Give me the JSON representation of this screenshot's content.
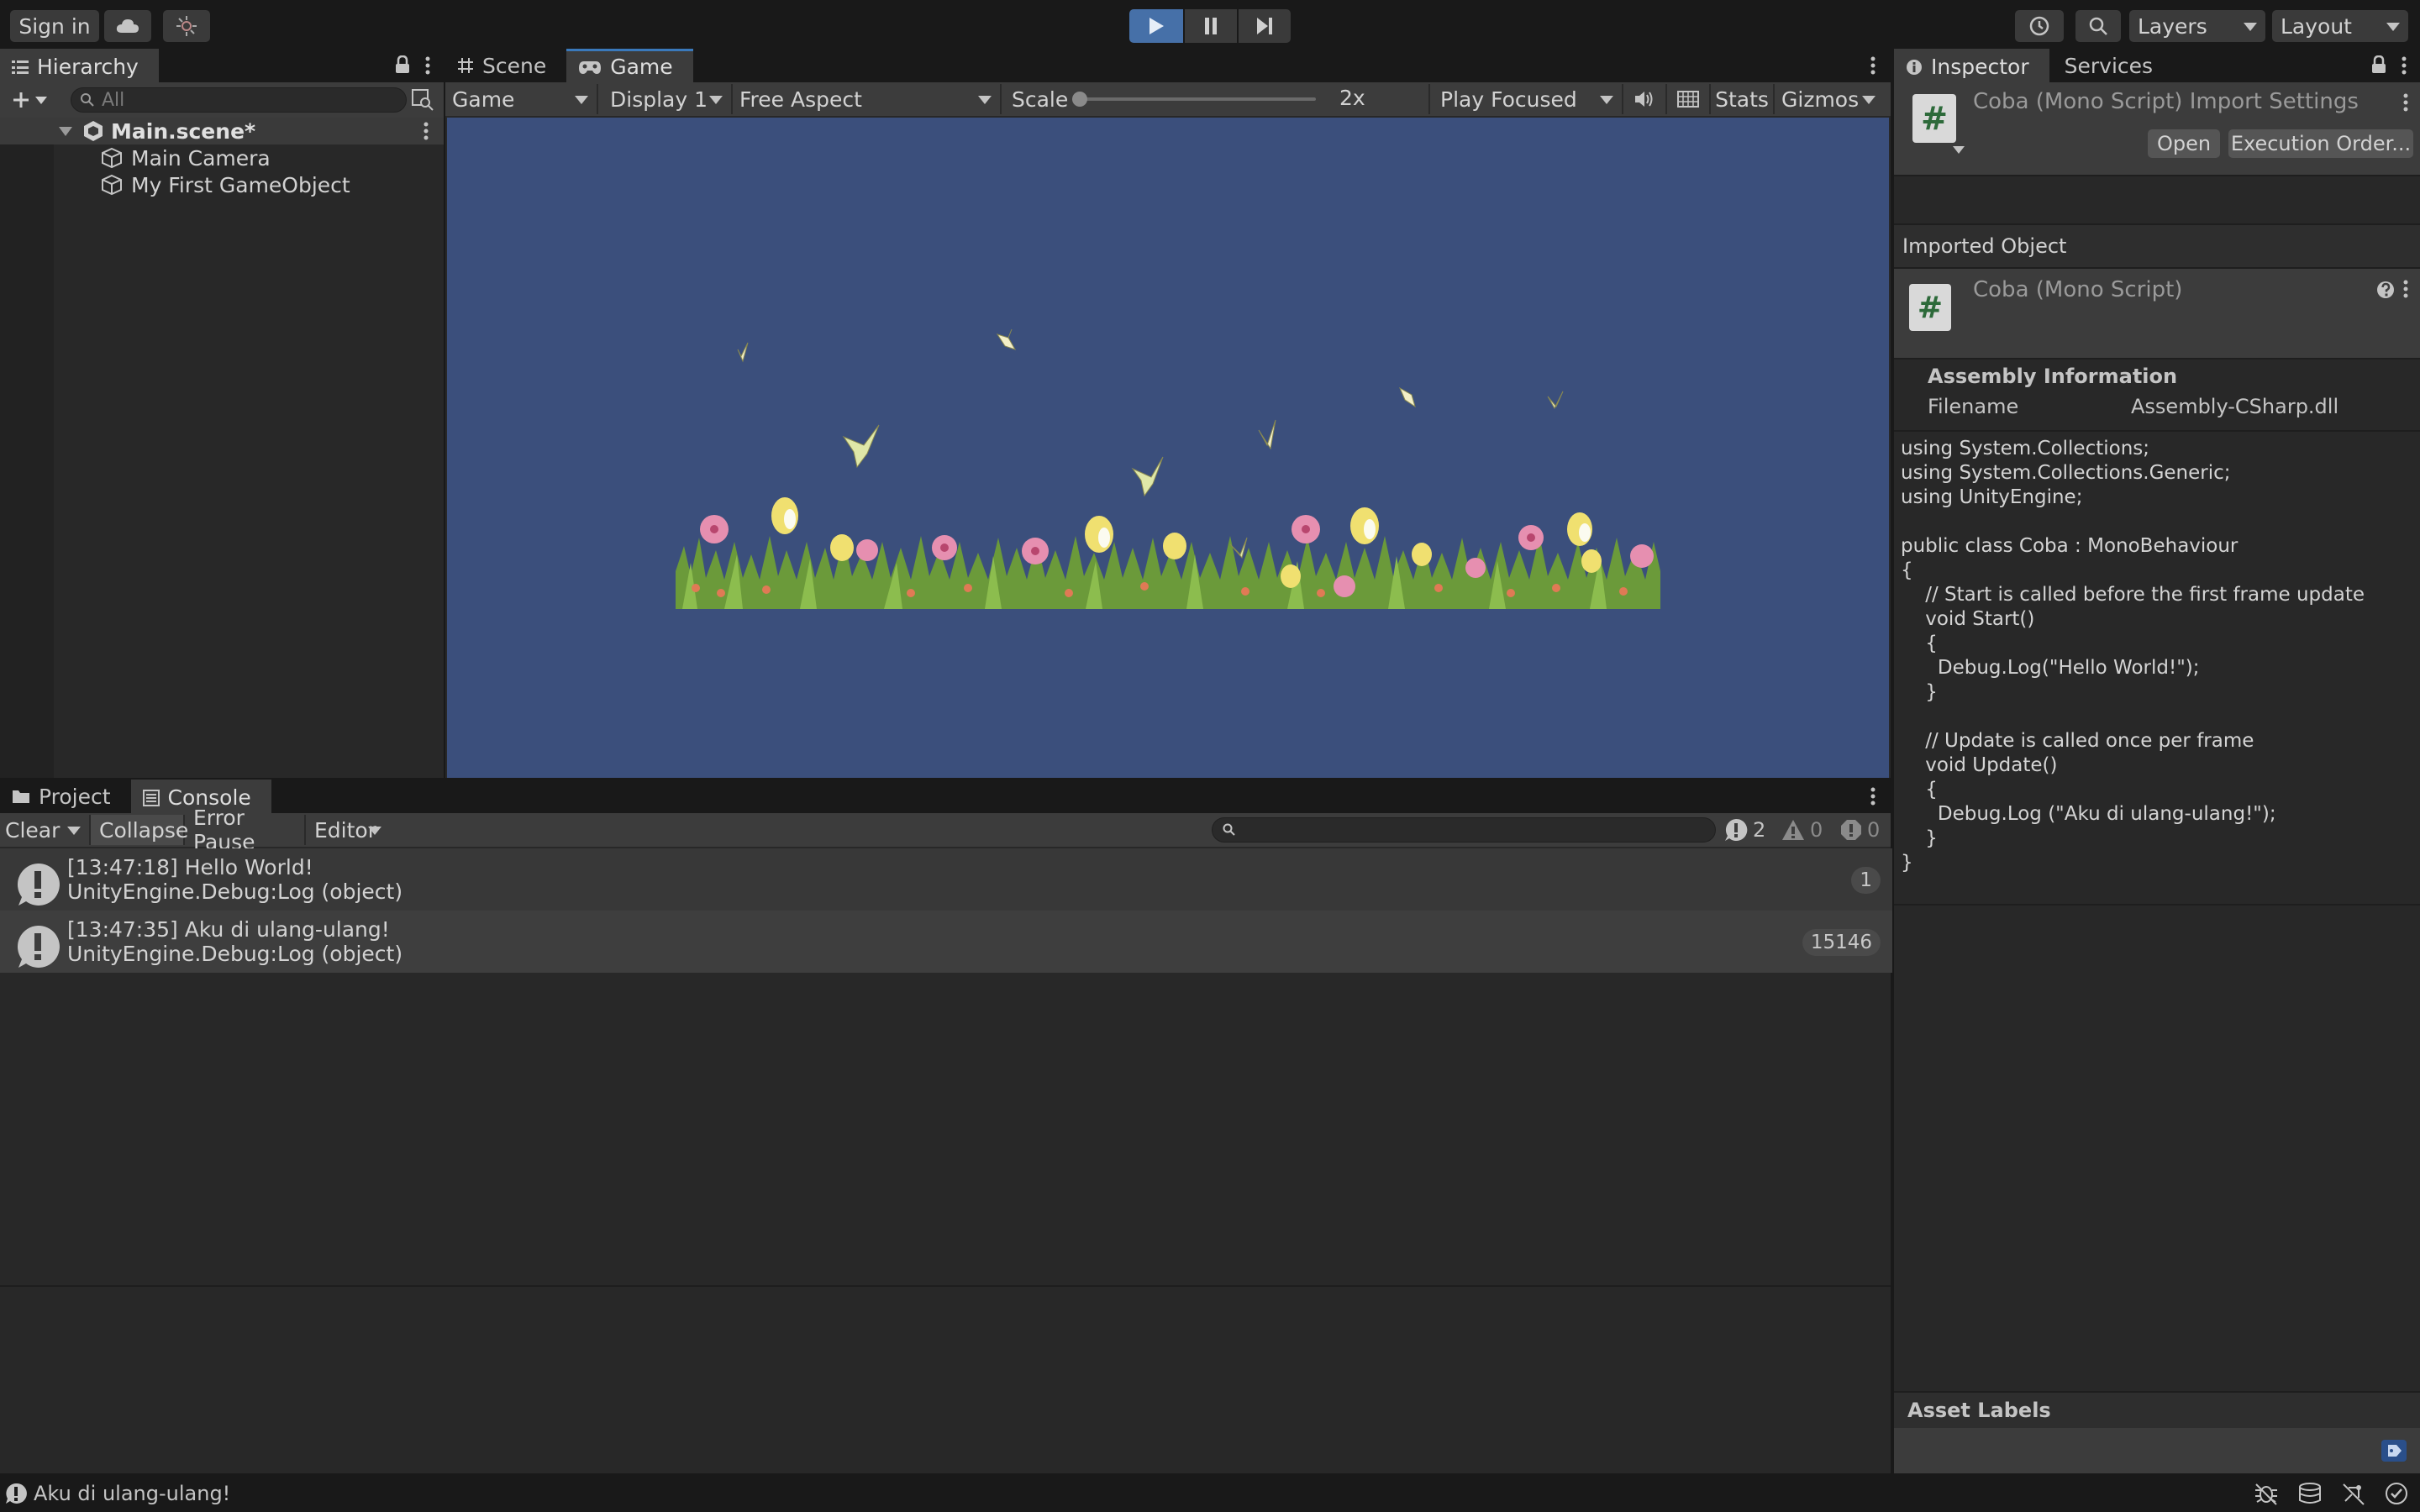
{
  "toolbar": {
    "sign_in": "Sign in",
    "layers": "Layers",
    "layout": "Layout"
  },
  "hierarchy": {
    "tab": "Hierarchy",
    "search_placeholder": "All",
    "scene": "Main.scene*",
    "objects": [
      "Main Camera",
      "My First GameObject"
    ]
  },
  "game_view": {
    "tabs": [
      "Scene",
      "Game"
    ],
    "view_select": "Game",
    "display": "Display 1",
    "aspect": "Free Aspect",
    "scale_label": "Scale",
    "scale_value": "2x",
    "play_mode": "Play Focused",
    "stats": "Stats",
    "gizmos": "Gizmos",
    "background_color": "#3b4f7c"
  },
  "inspector": {
    "tabs": [
      "Inspector",
      "Services"
    ],
    "title": "Coba (Mono Script) Import Settings",
    "open_button": "Open",
    "execution_order_button": "Execution Order...",
    "imported_object": "Imported Object",
    "object_name": "Coba (Mono Script)",
    "assembly_header": "Assembly Information",
    "filename_label": "Filename",
    "filename_value": "Assembly-CSharp.dll",
    "code": [
      "using System.Collections;",
      "using System.Collections.Generic;",
      "using UnityEngine;",
      "",
      "public class Coba : MonoBehaviour",
      "{",
      "    // Start is called before the first frame update",
      "    void Start()",
      "    {",
      "      Debug.Log(\"Hello World!\");",
      "    }",
      "",
      "    // Update is called once per frame",
      "    void Update()",
      "    {",
      "      Debug.Log (\"Aku di ulang-ulang!\");",
      "    }",
      "}"
    ],
    "asset_labels": "Asset Labels"
  },
  "console": {
    "tabs": [
      "Project",
      "Console"
    ],
    "clear": "Clear",
    "collapse": "Collapse",
    "error_pause": "Error Pause",
    "editor": "Editor",
    "count_info": "2",
    "count_warn": "0",
    "count_error": "0",
    "entries": [
      {
        "message": "[13:47:18] Hello World!",
        "trace": "UnityEngine.Debug:Log (object)",
        "count": "1"
      },
      {
        "message": "[13:47:35] Aku di ulang-ulang!",
        "trace": "UnityEngine.Debug:Log (object)",
        "count": "15146"
      }
    ]
  },
  "status_bar": {
    "message": "Aku di ulang-ulang!"
  },
  "icons": [
    "cloud-icon",
    "collab-icon",
    "play-icon",
    "pause-icon",
    "step-icon",
    "history-icon",
    "search-icon",
    "add-icon",
    "lock-icon",
    "kebab-icon",
    "unity-scene-icon",
    "gameobject-icon",
    "scene-grid-icon",
    "gamepad-icon",
    "audio-icon",
    "grid-icon",
    "info-icon",
    "csharp-script-icon",
    "help-icon",
    "project-folder-icon",
    "console-icon",
    "warning-icon",
    "error-icon",
    "tag-icon",
    "bug-icon",
    "cache-icon",
    "network-icon",
    "check-icon"
  ]
}
